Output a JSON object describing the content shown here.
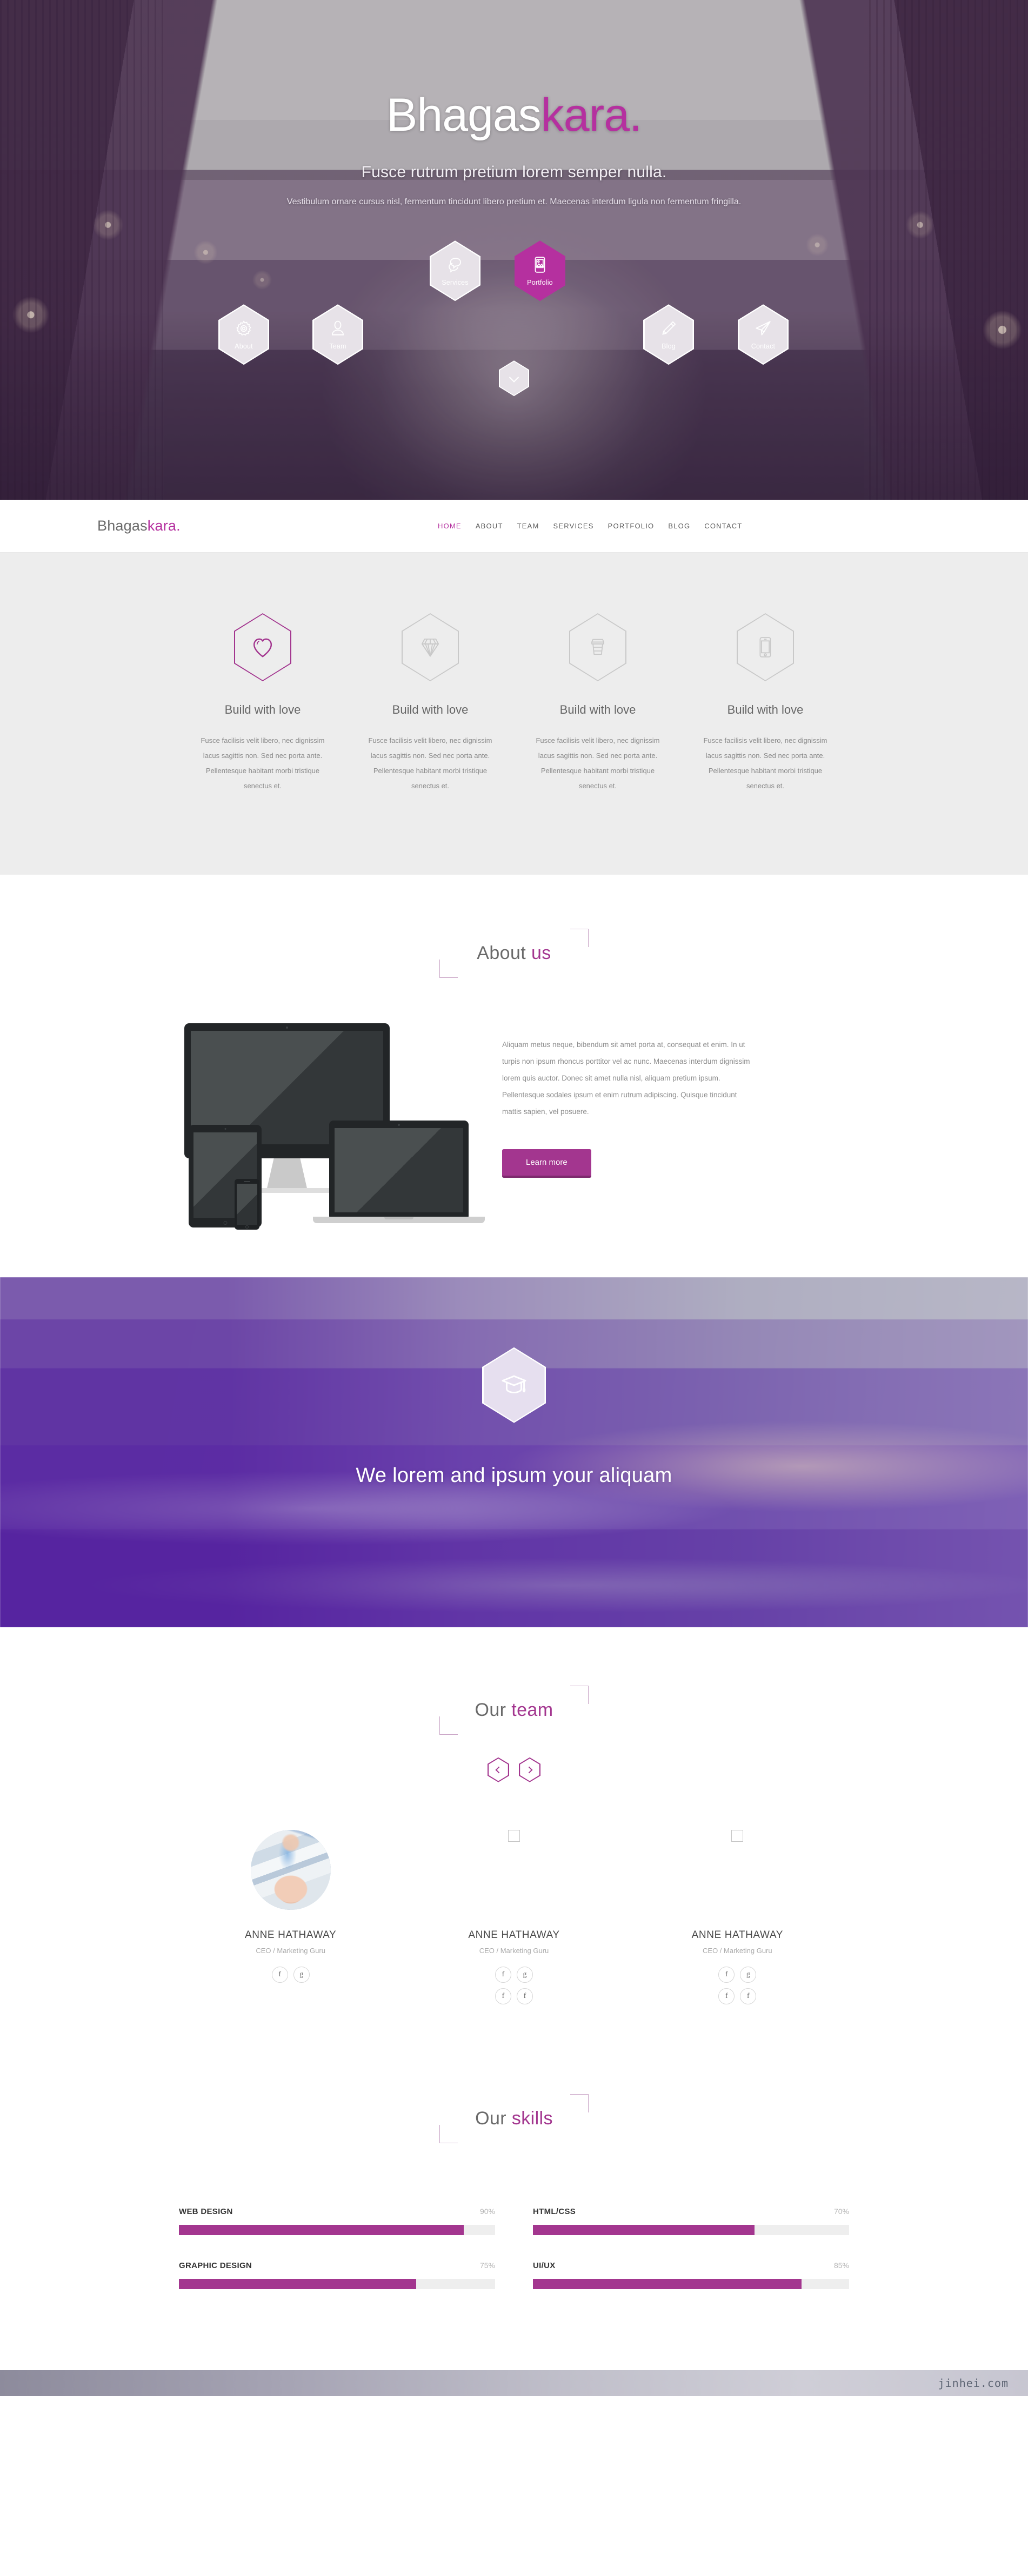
{
  "brand": {
    "name_dark": "Bhagas",
    "name_accent": "kara.",
    "accent_color": "#b5309f"
  },
  "hero": {
    "title_dark": "Bhagas",
    "title_accent": "kara.",
    "subtitle": "Fusce rutrum pretium lorem semper nulla.",
    "description": "Vestibulum ornare cursus nisl, fermentum tincidunt libero pretium et. Maecenas interdum ligula non fermentum fringilla.",
    "hex_nav": [
      {
        "label": "About",
        "icon": "gear-icon",
        "active": false
      },
      {
        "label": "Team",
        "icon": "person-icon",
        "active": false
      },
      {
        "label": "Services",
        "icon": "chat-bubble-icon",
        "active": false
      },
      {
        "label": "Portfolio",
        "icon": "image-phone-icon",
        "active": true
      },
      {
        "label": "Blog",
        "icon": "pencil-icon",
        "active": false
      },
      {
        "label": "Contact",
        "icon": "paper-plane-icon",
        "active": false
      }
    ],
    "scroll_icon": "chevron-down-icon"
  },
  "navbar": {
    "brand_dark": "Bhagas",
    "brand_accent": "kara.",
    "menu": [
      {
        "label": "HOME",
        "active": true
      },
      {
        "label": "ABOUT",
        "active": false
      },
      {
        "label": "TEAM",
        "active": false
      },
      {
        "label": "SERVICES",
        "active": false
      },
      {
        "label": "PORTFOLIO",
        "active": false
      },
      {
        "label": "BLOG",
        "active": false
      },
      {
        "label": "CONTACT",
        "active": false
      }
    ]
  },
  "services": {
    "items": [
      {
        "icon": "heart-icon",
        "title": "Build with love",
        "text": "Fusce facilisis velit libero, nec dignissim lacus sagittis non. Sed nec porta ante. Pellentesque habitant morbi tristique senectus et.",
        "active": true
      },
      {
        "icon": "diamond-icon",
        "title": "Build with love",
        "text": "Fusce facilisis velit libero, nec dignissim lacus sagittis non. Sed nec porta ante. Pellentesque habitant morbi tristique senectus et.",
        "active": false
      },
      {
        "icon": "coffee-cup-icon",
        "title": "Build with love",
        "text": "Fusce facilisis velit libero, nec dignissim lacus sagittis non. Sed nec porta ante. Pellentesque habitant morbi tristique senectus et.",
        "active": false
      },
      {
        "icon": "smartphone-icon",
        "title": "Build with love",
        "text": "Fusce facilisis velit libero, nec dignissim lacus sagittis non. Sed nec porta ante. Pellentesque habitant morbi tristique senectus et.",
        "active": false
      }
    ]
  },
  "about": {
    "heading_dark": "About ",
    "heading_accent": "us",
    "paragraph": "Aliquam metus neque, bibendum sit amet porta at, consequat et enim. In ut turpis non ipsum rhoncus porttitor vel ac nunc. Maecenas interdum dignissim lorem quis auctor. Donec sit amet nulla nisl, aliquam pretium ipsum. Pellentesque sodales ipsum et enim rutrum adipiscing. Quisque tincidunt mattis sapien, vel posuere.",
    "button_label": "Learn more",
    "image_alt": "responsive-devices-mockup"
  },
  "banner": {
    "icon": "graduation-cap-icon",
    "title": "We lorem and ipsum your aliquam"
  },
  "team": {
    "heading_dark": "Our ",
    "heading_accent": "team",
    "prev_icon": "chevron-left-icon",
    "next_icon": "chevron-right-icon",
    "members": [
      {
        "name": "ANNE HATHAWAY",
        "role": "CEO / Marketing Guru",
        "has_photo": true,
        "socials": [
          "f",
          "g"
        ]
      },
      {
        "name": "ANNE HATHAWAY",
        "role": "CEO / Marketing Guru",
        "has_photo": false,
        "socials": [
          "f",
          "g",
          "f",
          "f"
        ]
      },
      {
        "name": "ANNE HATHAWAY",
        "role": "CEO / Marketing Guru",
        "has_photo": false,
        "socials": [
          "f",
          "g",
          "f",
          "f"
        ]
      }
    ]
  },
  "skills": {
    "heading_dark": "Our ",
    "heading_accent": "skills",
    "items": [
      {
        "name": "WEB DESIGN",
        "percent": "90%",
        "value": 90
      },
      {
        "name": "HTML/CSS",
        "percent": "70%",
        "value": 70
      },
      {
        "name": "GRAPHIC DESIGN",
        "percent": "75%",
        "value": 75
      },
      {
        "name": "UI/UX",
        "percent": "85%",
        "value": 85
      }
    ]
  },
  "footer": {
    "watermark": "jinhei.com"
  }
}
